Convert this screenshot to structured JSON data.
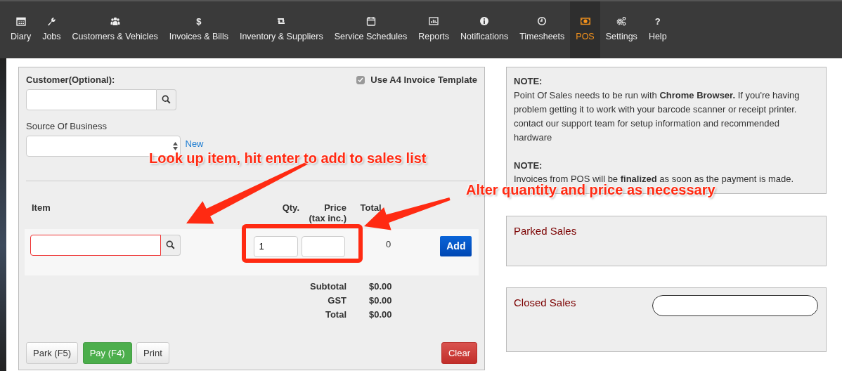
{
  "nav": [
    {
      "label": "Diary",
      "selected": false
    },
    {
      "label": "Jobs",
      "selected": false
    },
    {
      "label": "Customers & Vehicles",
      "selected": false
    },
    {
      "label": "Invoices & Bills",
      "symbol": "$",
      "selected": false
    },
    {
      "label": "Inventory & Suppliers",
      "selected": false
    },
    {
      "label": "Service Schedules",
      "selected": false
    },
    {
      "label": "Reports",
      "selected": false
    },
    {
      "label": "Notifications",
      "selected": false
    },
    {
      "label": "Timesheets",
      "selected": false
    },
    {
      "label": "POS",
      "selected": true
    },
    {
      "label": "Settings",
      "selected": false
    },
    {
      "label": "Help",
      "symbol": "?",
      "selected": false
    }
  ],
  "sale_form": {
    "customer_label": "Customer(Optional):",
    "a4_template": {
      "label": "Use A4 Invoice Template",
      "checked": true
    },
    "source_label": "Source Of Business",
    "source_link": "New",
    "columns": {
      "item": "Item",
      "qty": "Qty.",
      "price": "Price",
      "price_note": "(tax inc.)",
      "total": "Total"
    },
    "line": {
      "item_invalid": true,
      "qty": "1",
      "total": "0",
      "add_button": "Add"
    },
    "totals": [
      {
        "label": "Subtotal",
        "value": "$0.00"
      },
      {
        "label": "GST",
        "value": "$0.00"
      },
      {
        "label": "Total",
        "value": "$0.00"
      }
    ],
    "actions": [
      {
        "label": "Park (F5)",
        "kind": "default"
      },
      {
        "label": "Pay (F4)",
        "kind": "success"
      },
      {
        "label": "Print",
        "kind": "default"
      },
      {
        "label": "Clear",
        "kind": "danger"
      }
    ]
  },
  "notes": [
    {
      "title": "NOTE:",
      "text": "Point Of Sales needs to be run with **Chrome Browser.** If you're having problem getting it to work with your barcode scanner or receipt printer. contact our support team for setup information and recommended hardware"
    },
    {
      "title": "NOTE:",
      "text": "Invoices from POS will be **finalized** as soon as the payment is made."
    }
  ],
  "parked_sales": {
    "title": "Parked Sales"
  },
  "closed_sales": {
    "title": "Closed Sales",
    "search_field": true
  },
  "annotations": [
    {
      "text": "Look up item, hit enter to add to sales list"
    },
    {
      "text": "Alter quantity and price as necessary"
    }
  ]
}
